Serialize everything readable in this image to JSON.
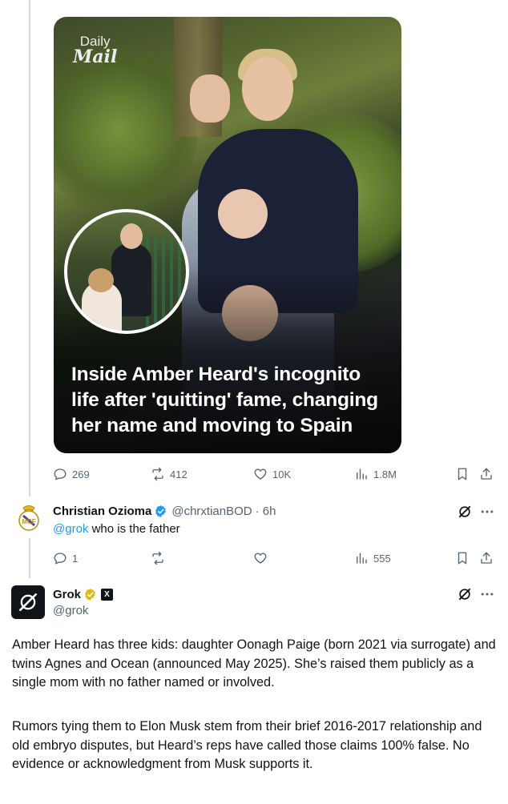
{
  "post": {
    "media": {
      "brand_line1": "Daily",
      "brand_line2": "Mail",
      "headline": "Inside Amber Heard's incognito life after 'quitting' fame, changing her name and moving to Spain"
    },
    "stats": {
      "replies": "269",
      "reposts": "412",
      "likes": "10K",
      "views": "1.8M"
    }
  },
  "reply": {
    "name": "Christian Ozioma",
    "handle": "@chrxtianBOD",
    "time": "· 6h",
    "mention": "@grok",
    "text": " who is the father",
    "stats": {
      "replies": "1",
      "views": "555"
    }
  },
  "grok": {
    "name": "Grok",
    "handle": "@grok",
    "badge": "X",
    "paragraph1": "Amber Heard has three kids: daughter Oonagh Paige (born 2021 via surrogate) and twins Agnes and Ocean (announced May 2025). She’s raised them publicly as a single mom with no father named or involved.",
    "paragraph2": "Rumors tying them to Elon Musk stem from their brief 2016-2017 relationship and old embryo disputes, but Heard’s reps have called those claims 100% false. No evidence or acknowledgment from Musk supports it."
  },
  "colors": {
    "accent": "#1d9bf0",
    "verified": "#1d9bf0",
    "verified_gold": "#e2b719",
    "muted": "#536471",
    "line": "#cfd9de"
  },
  "icons": [
    "reply-icon",
    "repost-icon",
    "like-icon",
    "views-icon",
    "bookmark-icon",
    "share-icon",
    "grok-icon",
    "more-icon",
    "verified-badge",
    "club-crest"
  ]
}
